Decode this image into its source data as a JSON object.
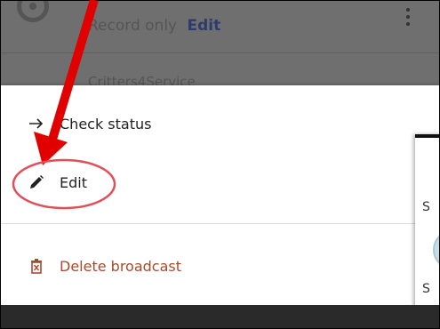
{
  "background_list": {
    "row1": {
      "title": "Record only",
      "edit_label": "Edit"
    },
    "row2": {
      "title": "Critters4Service"
    }
  },
  "menu": {
    "items": [
      {
        "label": "Check status",
        "icon": "arrow-right-icon"
      },
      {
        "label": "Edit",
        "icon": "pencil-icon"
      },
      {
        "label": "Delete broadcast",
        "icon": "trash-icon"
      }
    ]
  },
  "dialog_peek": {
    "section1_initial": "S",
    "section2_initial": "S"
  },
  "colors": {
    "delete": "#a84a2c",
    "annotation": "#e00000",
    "circle": "#e0505a",
    "edit_link": "#2b3d6d"
  }
}
